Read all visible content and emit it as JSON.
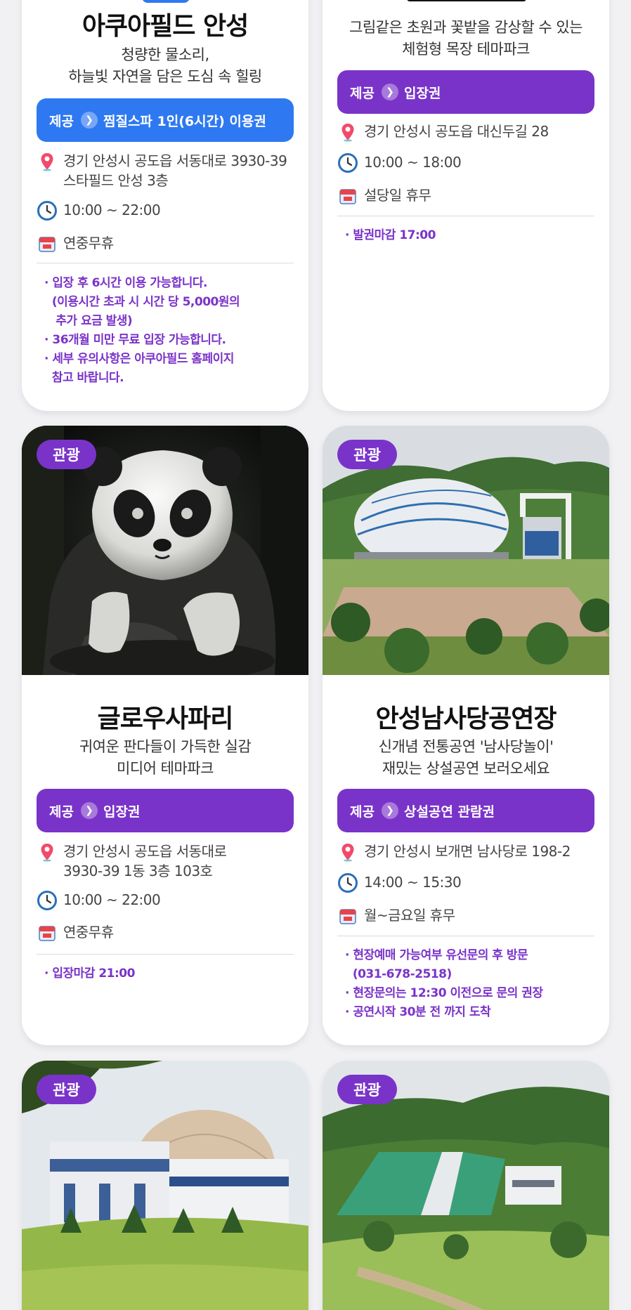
{
  "cards": [
    {
      "title": "아쿠아필드 안성",
      "subtitle_line1": "청량한 물소리,",
      "subtitle_line2": "하늘빛 자연을 담은 도심 속 힐링",
      "offer_prefix": "제공",
      "offer_label": "찜질스파 1인(6시간) 이용권",
      "address_line1": "경기 안성시 공도읍 서동대로 3930-39",
      "address_line2": "스타필드 안성 3층",
      "hours": "10:00 ~ 22:00",
      "closed": "연중무휴",
      "notes": [
        "· 입장 후 6시간 이용 가능합니다.",
        "  (이용시간 초과 시 시간 당 5,000원의",
        "   추가 요금 발생)",
        "· 36개월 미만 무료 입장 가능합니다.",
        "· 세부 유의사항은 아쿠아필드 홈페이지",
        "  참고 바랍니다."
      ]
    },
    {
      "title": "",
      "subtitle_line1": "그림같은 초원과 꽃밭을 감상할 수 있는",
      "subtitle_line2": "체험형 목장 테마파크",
      "offer_prefix": "제공",
      "offer_label": "입장권",
      "address_line1": "경기 안성시 공도읍 대신두길 28",
      "hours": "10:00 ~ 18:00",
      "closed": "설당일 휴무",
      "notes": [
        "· 발권마감 17:00"
      ]
    },
    {
      "tag": "관광",
      "title": "글로우사파리",
      "subtitle_line1": "귀여운 판다들이 가득한 실감",
      "subtitle_line2": "미디어 테마파크",
      "offer_prefix": "제공",
      "offer_label": "입장권",
      "address_line1": "경기 안성시 공도읍 서동대로",
      "address_line2": "3930-39 1동 3층 103호",
      "hours": "10:00 ~ 22:00",
      "closed": "연중무휴",
      "notes": [
        "· 입장마감 21:00"
      ]
    },
    {
      "tag": "관광",
      "title": "안성남사당공연장",
      "subtitle_line1": "신개념 전통공연 '남사당놀이'",
      "subtitle_line2": "재밌는 상설공연 보러오세요",
      "offer_prefix": "제공",
      "offer_label": "상설공연 관람권",
      "address_line1": "경기 안성시 보개면 남사당로 198-2",
      "hours": "14:00 ~ 15:30",
      "closed": "월~금요일 휴무",
      "notes": [
        "· 현장예매 가능여부 유선문의 후 방문",
        "  (031-678-2518)",
        "· 현장문의는 12:30 이전으로 문의 권장",
        "· 공연시작 30분 전 까지 도착"
      ]
    },
    {
      "tag": "관광"
    },
    {
      "tag": "관광"
    }
  ],
  "icons": {
    "pin": "location-pin-icon",
    "clock": "clock-icon",
    "calendar": "calendar-day-icon",
    "chevron": "chevron-right-icon"
  },
  "colors": {
    "purple": "#7a33c9",
    "blue": "#2e79f2",
    "note": "#7a33c9"
  }
}
